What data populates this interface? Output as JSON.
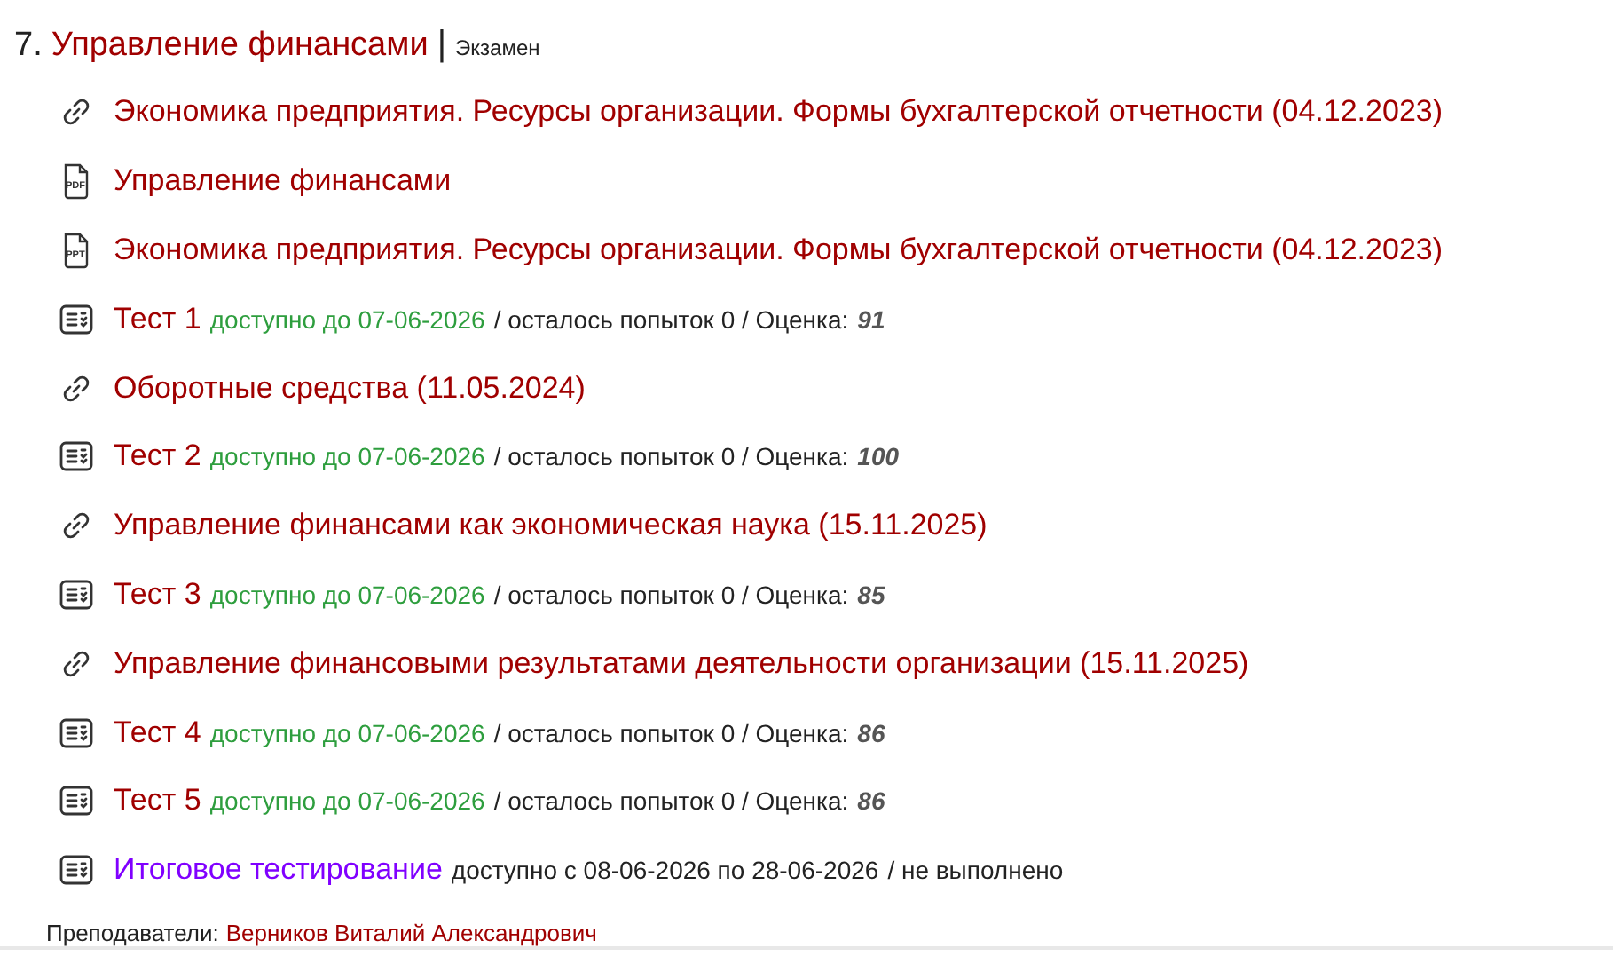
{
  "module": {
    "number": "7.",
    "title": "Управление финансами",
    "separator": "|",
    "type": "Экзамен"
  },
  "items": [
    {
      "kind": "link",
      "title": "Экономика предприятия. Ресурсы организации. Формы бухгалтерской отчетности (04.12.2023)"
    },
    {
      "kind": "file",
      "icon_label": "PDF",
      "title": "Управление финансами"
    },
    {
      "kind": "file",
      "icon_label": "PPT",
      "title": "Экономика предприятия. Ресурсы организации. Формы бухгалтерской отчетности (04.12.2023)"
    },
    {
      "kind": "test",
      "title": "Тест 1",
      "availability": "доступно до 07-06-2026",
      "status": "/ осталось попыток 0 / Оценка:",
      "grade": "91"
    },
    {
      "kind": "link",
      "title": "Оборотные средства (11.05.2024)"
    },
    {
      "kind": "test",
      "title": "Тест 2",
      "availability": "доступно до 07-06-2026",
      "status": "/ осталось попыток 0 / Оценка:",
      "grade": "100"
    },
    {
      "kind": "link",
      "title": "Управление финансами как экономическая наука (15.11.2025)"
    },
    {
      "kind": "test",
      "title": "Тест 3",
      "availability": "доступно до 07-06-2026",
      "status": "/ осталось попыток 0 / Оценка:",
      "grade": "85"
    },
    {
      "kind": "link",
      "title": "Управление финансовыми результатами деятельности организации (15.11.2025)"
    },
    {
      "kind": "test",
      "title": "Тест 4",
      "availability": "доступно до 07-06-2026",
      "status": "/ осталось попыток 0 / Оценка:",
      "grade": "86"
    },
    {
      "kind": "test",
      "title": "Тест 5",
      "availability": "доступно до 07-06-2026",
      "status": "/ осталось попыток 0 / Оценка:",
      "grade": "86"
    },
    {
      "kind": "final-test",
      "title": "Итоговое тестирование",
      "availability": "доступно с 08-06-2026 по 28-06-2026",
      "status": "/ не выполнено"
    }
  ],
  "teachers": {
    "label": "Преподаватели:",
    "name": "Верников Виталий Александрович"
  }
}
